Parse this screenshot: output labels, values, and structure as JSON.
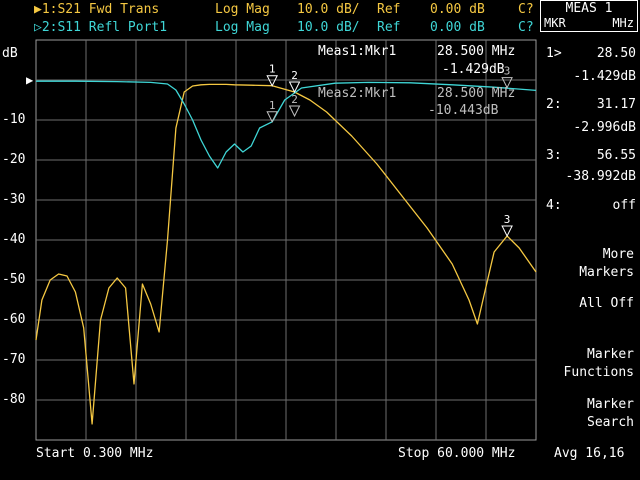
{
  "traces": [
    {
      "marker_symbol": "▶",
      "label": "1:S21 Fwd Trans",
      "format": "Log Mag",
      "scale": "10.0 dB/",
      "ref_label": "Ref",
      "ref_value": "0.00 dB",
      "cal": "C?",
      "color": "#f5c842"
    },
    {
      "marker_symbol": "▷",
      "label": "2:S11 Refl Port1",
      "format": "Log Mag",
      "scale": "10.0 dB/",
      "ref_label": "Ref",
      "ref_value": "0.00 dB",
      "cal": "C?",
      "color": "#3fd6d6"
    }
  ],
  "y_unit": "dB",
  "ref_arrow": "▶",
  "meas1": {
    "label": "Meas1:Mkr1",
    "freq": "28.500 MHz",
    "value": "-1.429dB"
  },
  "meas2": {
    "label": "Meas2:Mkr1",
    "freq": "28.500 MHz",
    "value": "-10.443dB"
  },
  "footer": {
    "start": "Start 0.300 MHz",
    "stop": "Stop 60.000 MHz",
    "avg": "Avg 16,16"
  },
  "meas_box": {
    "title": "MEAS 1",
    "left": "MKR",
    "right": "MHz"
  },
  "markers_readout": [
    {
      "num": "1>",
      "freq": "28.50",
      "value": "-1.429dB"
    },
    {
      "num": "2:",
      "freq": "31.17",
      "value": "-2.996dB"
    },
    {
      "num": "3:",
      "freq": "56.55",
      "value": "-38.992dB"
    },
    {
      "num": "4:",
      "freq": "off",
      "value": ""
    }
  ],
  "softkeys": [
    {
      "line1": "More",
      "line2": "Markers"
    },
    {
      "line1": "All Off",
      "line2": ""
    },
    {
      "line1": "Marker",
      "line2": "Functions"
    },
    {
      "line1": "Marker",
      "line2": "Search"
    }
  ],
  "chart_data": {
    "type": "line",
    "xlabel": "",
    "ylabel": "dB",
    "xlim": [
      0.3,
      60.0
    ],
    "ylim": [
      -90,
      10
    ],
    "y_ticks": [
      "-10",
      "-20",
      "-30",
      "-40",
      "-50",
      "-60",
      "-70",
      "-80"
    ],
    "grid": true,
    "series": [
      {
        "name": "1:S21 Fwd Trans",
        "color": "#f5c842",
        "x": [
          0.3,
          1,
          2,
          3,
          4,
          5,
          6,
          7,
          8,
          9,
          10,
          11,
          12,
          13,
          14,
          15,
          16,
          17,
          18,
          19,
          20,
          21,
          22,
          23,
          24,
          26,
          28.5,
          31.17,
          33,
          35,
          38,
          41,
          44,
          47,
          50,
          52,
          53,
          54,
          55,
          56.55,
          58,
          60
        ],
        "y": [
          -65,
          -55,
          -50,
          -48.5,
          -49,
          -53,
          -62,
          -86,
          -60,
          -52,
          -49.5,
          -52,
          -76,
          -51,
          -56,
          -63,
          -40,
          -12,
          -3,
          -1.5,
          -1.2,
          -1.1,
          -1.1,
          -1.1,
          -1.2,
          -1.3,
          -1.429,
          -2.996,
          -5,
          -8,
          -14,
          -21,
          -29,
          -37,
          -46,
          -55,
          -61,
          -52,
          -43,
          -38.992,
          -42,
          -48
        ]
      },
      {
        "name": "2:S11 Refl Port1",
        "color": "#3fd6d6",
        "x": [
          0.3,
          5,
          10,
          14,
          16,
          17,
          18,
          19,
          20,
          21,
          22,
          23,
          24,
          25,
          26,
          27,
          28.5,
          30,
          32,
          36,
          40,
          45,
          50,
          55,
          60
        ],
        "y": [
          -0.3,
          -0.3,
          -0.4,
          -0.6,
          -1,
          -2.5,
          -6,
          -10,
          -15,
          -19,
          -22,
          -18,
          -16,
          -18,
          -16.5,
          -12,
          -10.443,
          -5,
          -2,
          -0.8,
          -0.6,
          -0.7,
          -1.2,
          -1.8,
          -2.6
        ]
      }
    ],
    "markers": [
      {
        "trace": "1:S21 Fwd Trans",
        "id": "1",
        "x": 28.5,
        "y": -1.429
      },
      {
        "trace": "1:S21 Fwd Trans",
        "id": "2",
        "x": 31.17,
        "y": -2.996
      },
      {
        "trace": "1:S21 Fwd Trans",
        "id": "3",
        "x": 56.55,
        "y": -38.992
      },
      {
        "trace": "2:S11 Refl Port1",
        "id": "1",
        "x": 28.5,
        "y": -10.443
      },
      {
        "trace": "2:S11 Refl Port1",
        "id": "2",
        "x": 31.17,
        "y": -9
      },
      {
        "trace": "2:S11 Refl Port1",
        "id": "3",
        "x": 56.55,
        "y": -1.9
      }
    ]
  }
}
